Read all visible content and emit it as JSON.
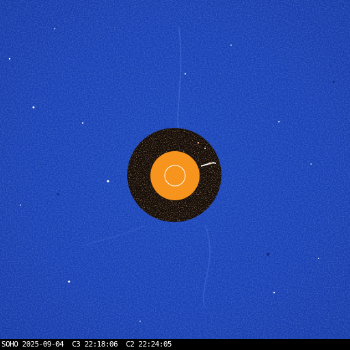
{
  "caption": "SOHO 2025-09-04  C3 22:18:06  C2 22:24:05",
  "colors": {
    "c3_background": "#1a3fb5",
    "c2_background": "#140d08",
    "occulter_disk": "#f7941d",
    "solar_limb_circle": "#ffffff",
    "caption_bar": "#000000",
    "caption_text": "#ffffff"
  }
}
